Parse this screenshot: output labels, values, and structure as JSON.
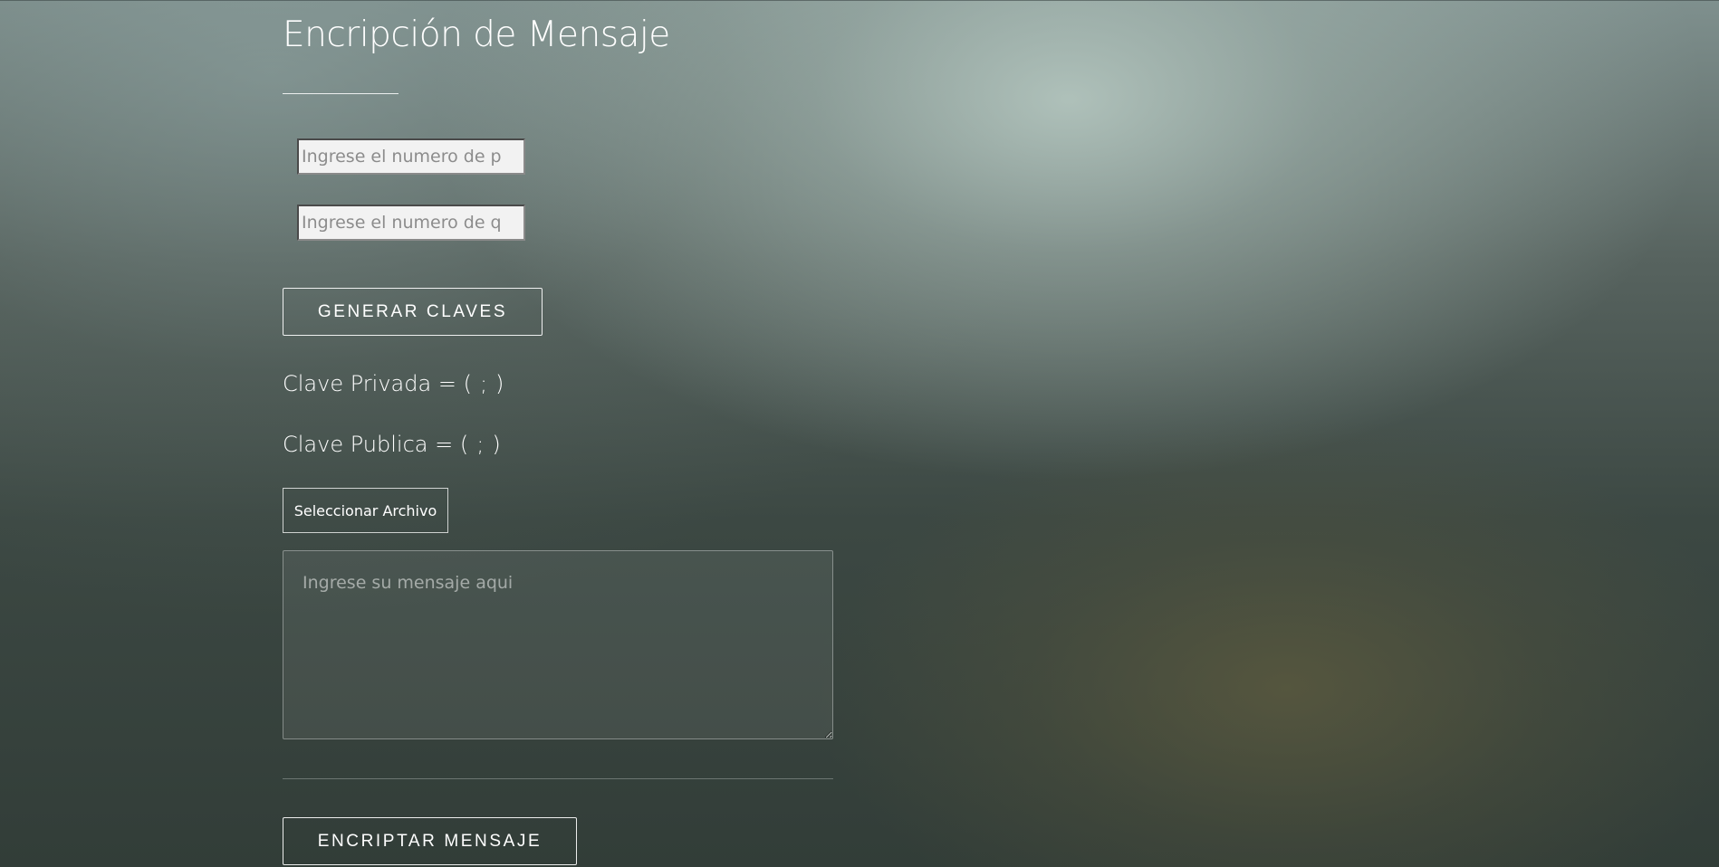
{
  "page": {
    "title": "Encripción de Mensaje"
  },
  "form": {
    "p_placeholder": "Ingrese el numero de p",
    "q_placeholder": "Ingrese el numero de q",
    "generate_button": "GENERAR CLAVES",
    "file_button": "Seleccionar Archivo",
    "message_placeholder": "Ingrese su mensaje aqui",
    "encrypt_button": "ENCRIPTAR MENSAJE"
  },
  "keys": {
    "private_label": "Clave Privada",
    "public_label": "Clave Publica",
    "equals": "=",
    "open_paren": "(",
    "separator": ";",
    "close_paren": ")",
    "private_value_1": "",
    "private_value_2": "",
    "public_value_1": "",
    "public_value_2": ""
  }
}
